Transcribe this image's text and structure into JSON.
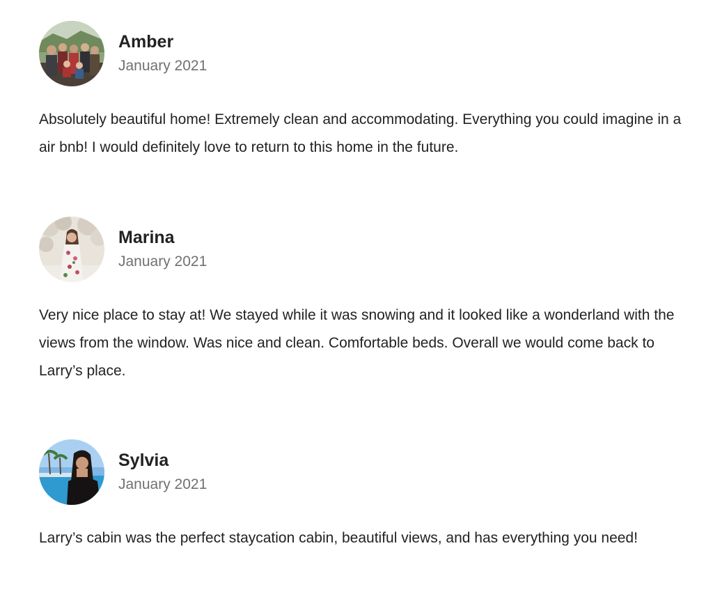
{
  "reviews": [
    {
      "name": "Amber",
      "date": "January 2021",
      "text": "Absolutely beautiful home! Extremely clean and accommodating. Everything you could imagine in a air bnb! I would definitely love to return to this home in the future.",
      "avatar_icon": "family-photo-avatar"
    },
    {
      "name": "Marina",
      "date": "January 2021",
      "text": "Very nice place to stay at! We stayed while it was snowing and it looked like a wonderland with the views from the window. Was nice and clean. Comfortable beds. Overall we would come back to Larry’s place.",
      "avatar_icon": "woman-blossoms-avatar"
    },
    {
      "name": "Sylvia",
      "date": "January 2021",
      "text": "Larry’s cabin was the perfect staycation cabin, beautiful views, and has everything you need!",
      "avatar_icon": "woman-pool-avatar"
    }
  ],
  "colors": {
    "name_text": "#222222",
    "date_text": "#717171",
    "body_text": "#222222",
    "background": "#ffffff"
  }
}
